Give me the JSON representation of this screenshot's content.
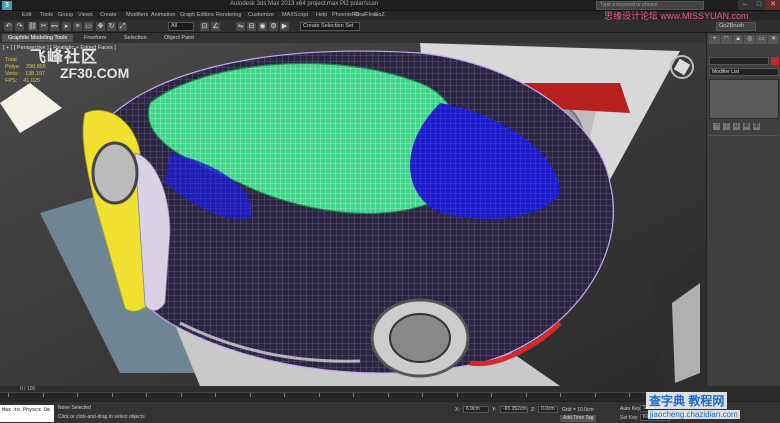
{
  "title_bar": {
    "app_logo": "3",
    "window_title": "Autodesk 3ds Max 2013 x64    project.max Pl2 polar/scan",
    "search_placeholder": "Type a keyword or phrase",
    "minimize": "–",
    "maximize": "□",
    "close": "✕"
  },
  "menu": [
    "Edit",
    "Tools",
    "Group",
    "Views",
    "Create",
    "Modifiers",
    "Animation",
    "Graph Editors",
    "Rendering",
    "Customize",
    "MAXScript",
    "Help",
    "PhoenixFD",
    "RealFlow",
    "GoZ"
  ],
  "toolbar": {
    "selection_filter": "All",
    "reference_coord": "View",
    "named_selection": "Create Selection Set",
    "icons": [
      "undo-icon",
      "redo-icon",
      "link-icon",
      "unlink-icon",
      "bind-icon",
      "select-icon",
      "select-by-name-icon",
      "rect-selection-icon",
      "move-icon",
      "rotate-icon",
      "scale-icon",
      "snap-icon",
      "angle-snap-icon",
      "mirror-icon",
      "align-icon",
      "material-editor-icon",
      "render-setup-icon",
      "render-icon"
    ],
    "right_label": "GoZBrush"
  },
  "ribbon": {
    "tabs": [
      "Graphite Modeling Tools",
      "Freeform",
      "Selection",
      "Object Paint"
    ],
    "active_tab": 0
  },
  "viewport": {
    "label": "[ + ] [ Perspective ] [ Realistic + Edged Faces ]",
    "stats": [
      {
        "label": "Total",
        "value": ""
      },
      {
        "label": "Polys:",
        "value": "298,866"
      },
      {
        "label": "Verts:",
        "value": "138,197"
      },
      {
        "label": "FPS:",
        "value": "41.025"
      }
    ]
  },
  "watermark": {
    "site_cn": "飞峰社区",
    "site_en": "ZF30.COM",
    "right_cn": "思缘设计论坛",
    "right_url": "www.MISSYUAN.com",
    "bottom_cn": "查字典 教程网",
    "bottom_url": "jiaocheng.chazidian.com"
  },
  "command_panel": {
    "tabs": [
      "+",
      "◠",
      "▲",
      "◎",
      "▭",
      "✕"
    ],
    "modifier_list": "Modifier List",
    "object_color": "#c02a2a",
    "stack_icons": [
      "pin-stack-icon",
      "show-end-result-icon",
      "make-unique-icon",
      "remove-modifier-icon",
      "configure-icon"
    ]
  },
  "time_slider": {
    "frame_label": "0 / 100",
    "ticks": [
      0,
      5,
      10,
      15,
      20,
      25,
      30,
      35,
      40,
      45,
      50,
      55,
      60,
      65,
      70,
      75,
      80,
      85,
      90,
      95,
      100
    ]
  },
  "status_bar": {
    "maxscript_line1": "Max to Physcs De",
    "maxscript_line2": "",
    "selection_status": "None Selected",
    "prompt": "Click or click-and-drag to select objects",
    "x_label": "X:",
    "x_value": "6.9cm",
    "y_label": "Y:",
    "y_value": "-65.352cm",
    "z_label": "Z:",
    "z_value": "0.0cm",
    "grid": "Grid = 10.0cm",
    "add_time_tag": "Add Time Tag",
    "auto_key": "Auto Key",
    "set_key": "Set Key",
    "selected": "Selected",
    "key_filters": "Key Filters..."
  },
  "colors": {
    "car_body_wire": "#c9a7f0",
    "glass_wire": "#43e08a",
    "panel_blue": "#1a1ad0",
    "door_yellow": "#f0e030",
    "accent_red": "#c02a2a"
  }
}
